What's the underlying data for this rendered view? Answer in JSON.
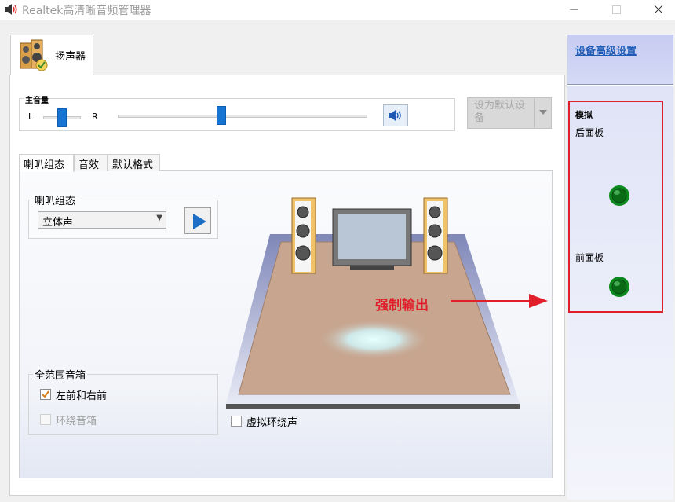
{
  "window": {
    "title": "Realtek高清晰音频管理器"
  },
  "tabs": {
    "speaker": "扬声器"
  },
  "volume": {
    "label": "主音量",
    "left": "L",
    "right": "R"
  },
  "buttons": {
    "set_default": "设为默认设备"
  },
  "subtabs": [
    "喇叭组态",
    "音效",
    "默认格式"
  ],
  "speaker_config": {
    "group_label": "喇叭组态",
    "selected": "立体声"
  },
  "full_range": {
    "group_label": "全范围音箱",
    "front": "左前和右前",
    "front_checked": true,
    "surround": "环绕音箱",
    "surround_checked": false
  },
  "virtual_surround": {
    "label": "虚拟环绕声",
    "checked": false
  },
  "annotation": {
    "text": "强制输出",
    "color": "#e11f2a"
  },
  "right_panel": {
    "advanced_link": "设备高级设置",
    "analog": "模拟",
    "rear": "后面板",
    "front": "前面板",
    "jack_color": "#0c8a1e"
  },
  "icons": {
    "app": "speaker-icon",
    "tab": "speaker-cabinet-icon",
    "mute": "volume-icon",
    "play": "play-icon",
    "dropdown": "chevron-down-icon",
    "jack": "audio-jack-icon"
  }
}
